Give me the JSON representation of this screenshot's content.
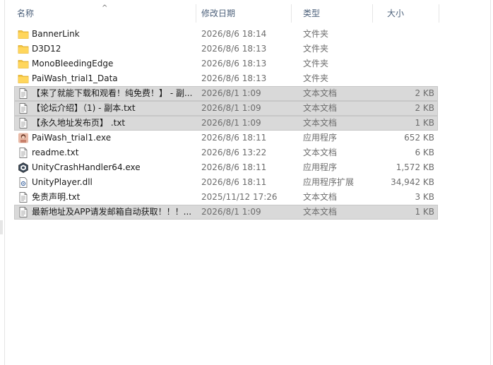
{
  "columns": {
    "name": "名称",
    "date": "修改日期",
    "type": "类型",
    "size": "大小",
    "sort_indicator": "^"
  },
  "files": [
    {
      "name": "BannerLink",
      "date": "2026/8/6 18:14",
      "type": "文件夹",
      "size": "",
      "icon": "folder-icon",
      "selected": false
    },
    {
      "name": "D3D12",
      "date": "2026/8/6 18:13",
      "type": "文件夹",
      "size": "",
      "icon": "folder-icon",
      "selected": false
    },
    {
      "name": "MonoBleedingEdge",
      "date": "2026/8/6 18:13",
      "type": "文件夹",
      "size": "",
      "icon": "folder-icon",
      "selected": false
    },
    {
      "name": "PaiWash_trial1_Data",
      "date": "2026/8/6 18:13",
      "type": "文件夹",
      "size": "",
      "icon": "folder-icon",
      "selected": false
    },
    {
      "name": "【来了就能下载和观看！纯免费！】 - 副...",
      "date": "2026/8/1 1:09",
      "type": "文本文档",
      "size": "2 KB",
      "icon": "text-document-icon",
      "selected": true
    },
    {
      "name": "【论坛介绍】（1) - 副本.txt",
      "date": "2026/8/1 1:09",
      "type": "文本文档",
      "size": "2 KB",
      "icon": "text-document-icon",
      "selected": true
    },
    {
      "name": "【永久地址发布页】 .txt",
      "date": "2026/8/1 1:09",
      "type": "文本文档",
      "size": "1 KB",
      "icon": "text-document-icon",
      "selected": true
    },
    {
      "name": "PaiWash_trial1.exe",
      "date": "2026/8/6 18:11",
      "type": "应用程序",
      "size": "652 KB",
      "icon": "game-app-icon",
      "selected": false
    },
    {
      "name": "readme.txt",
      "date": "2026/8/6 13:22",
      "type": "文本文档",
      "size": "6 KB",
      "icon": "text-document-icon",
      "selected": false
    },
    {
      "name": "UnityCrashHandler64.exe",
      "date": "2026/8/6 18:11",
      "type": "应用程序",
      "size": "1,572 KB",
      "icon": "unity-app-icon",
      "selected": false
    },
    {
      "name": "UnityPlayer.dll",
      "date": "2026/8/6 18:11",
      "type": "应用程序扩展",
      "size": "34,942 KB",
      "icon": "dll-file-icon",
      "selected": false
    },
    {
      "name": "免责声明.txt",
      "date": "2025/11/12 17:26",
      "type": "文本文档",
      "size": "3 KB",
      "icon": "text-document-icon",
      "selected": false
    },
    {
      "name": "最新地址及APP请发邮箱自动获取！！！...",
      "date": "2026/8/1 1:09",
      "type": "文本文档",
      "size": "1 KB",
      "icon": "text-document-icon",
      "selected": true
    }
  ],
  "colors": {
    "selection": "#d9d9d9",
    "folder": "#f4c542",
    "header_text": "#4c607a"
  }
}
